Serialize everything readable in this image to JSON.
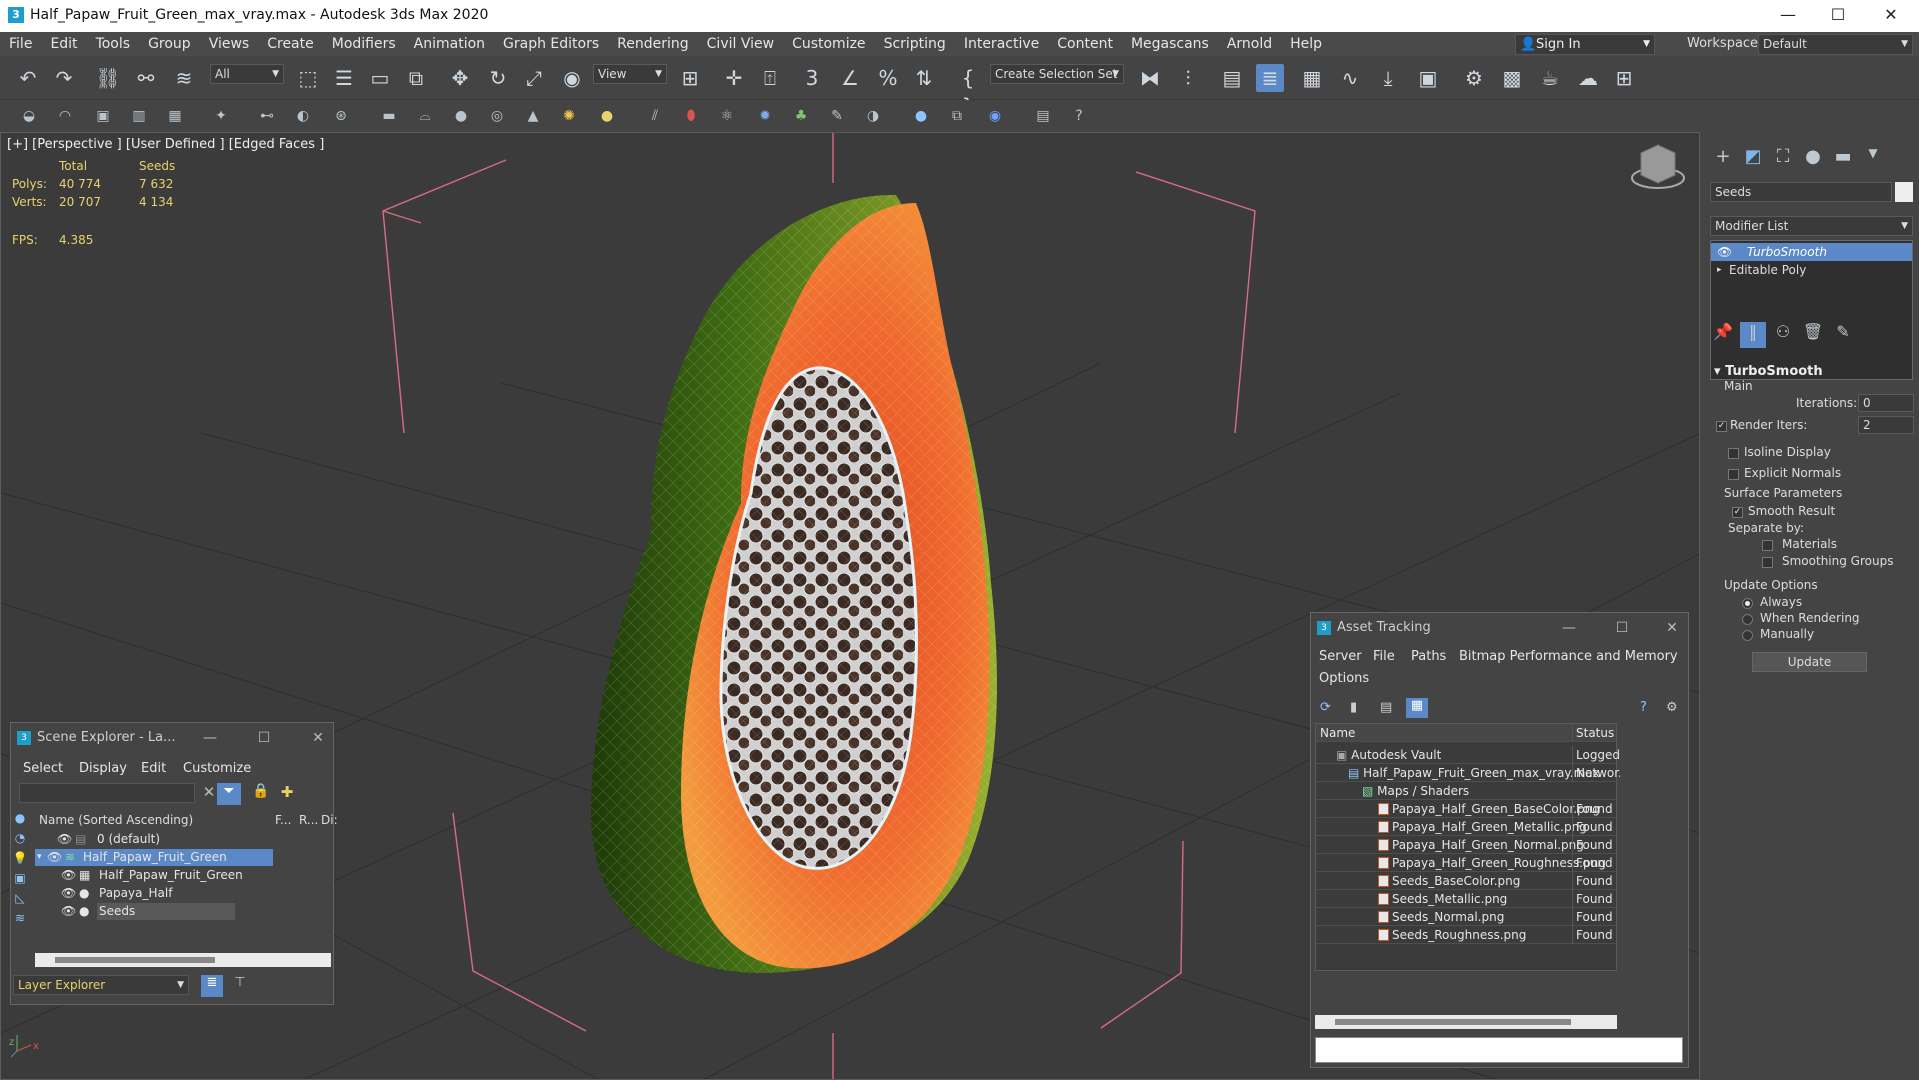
{
  "title_bar": {
    "title": "Half_Papaw_Fruit_Green_max_vray.max - Autodesk 3ds Max 2020"
  },
  "menu": [
    "File",
    "Edit",
    "Tools",
    "Group",
    "Views",
    "Create",
    "Modifiers",
    "Animation",
    "Graph Editors",
    "Rendering",
    "Civil View",
    "Customize",
    "Scripting",
    "Interactive",
    "Content",
    "Megascans",
    "Arnold",
    "Help"
  ],
  "header": {
    "sign_in": "Sign In",
    "workspaces_label": "Workspaces:",
    "workspaces_value": "Default"
  },
  "toolbar": {
    "filter_value": "All",
    "refcoord_value": "View",
    "selection_set": "Create Selection Set"
  },
  "viewport": {
    "label": "[+] [Perspective ] [User Defined ] [Edged Faces ]",
    "stats": {
      "col_total": "Total",
      "col_seeds": "Seeds",
      "polys_label": "Polys:",
      "polys_total": "40 774",
      "polys_seeds": "7 632",
      "verts_label": "Verts:",
      "verts_total": "20 707",
      "verts_seeds": "4 134",
      "fps_label": "FPS:",
      "fps_value": "4.385"
    }
  },
  "command_panel": {
    "object_name": "Seeds",
    "modifier_list": "Modifier List",
    "stack": [
      "TurboSmooth",
      "Editable Poly"
    ],
    "turbosmooth": {
      "title": "TurboSmooth",
      "main": "Main",
      "iterations_label": "Iterations:",
      "iterations_value": "0",
      "render_iters_label": "Render Iters:",
      "render_iters_value": "2",
      "isoline": "Isoline Display",
      "explicit_normals": "Explicit Normals",
      "surface_params": "Surface Parameters",
      "smooth_result": "Smooth Result",
      "separate_by": "Separate by:",
      "materials": "Materials",
      "smoothing_groups": "Smoothing Groups",
      "update_options": "Update Options",
      "always": "Always",
      "when_rendering": "When Rendering",
      "manually": "Manually",
      "update_button": "Update"
    }
  },
  "scene_explorer": {
    "title": "Scene Explorer - La...",
    "menu": [
      "Select",
      "Display",
      "Edit",
      "Customize"
    ],
    "col_name": "Name (Sorted Ascending)",
    "col_f": "F...",
    "col_r": "R...",
    "col_di": "Di:",
    "rows": [
      "0 (default)",
      "Half_Papaw_Fruit_Green",
      "Half_Papaw_Fruit_Green",
      "Papaya_Half",
      "Seeds"
    ],
    "footer": "Layer Explorer"
  },
  "asset_tracking": {
    "title": "Asset Tracking",
    "menu": [
      "Server",
      "File",
      "Paths",
      "Bitmap Performance and Memory"
    ],
    "menu2": "Options",
    "col_name": "Name",
    "col_status": "Status",
    "rows": [
      {
        "name": "Autodesk Vault",
        "status": "Logged..."
      },
      {
        "name": "Half_Papaw_Fruit_Green_max_vray.max",
        "status": "Networ..."
      },
      {
        "name": "Maps / Shaders",
        "status": ""
      },
      {
        "name": "Papaya_Half_Green_BaseColor.png",
        "status": "Found"
      },
      {
        "name": "Papaya_Half_Green_Metallic.png",
        "status": "Found"
      },
      {
        "name": "Papaya_Half_Green_Normal.png",
        "status": "Found"
      },
      {
        "name": "Papaya_Half_Green_Roughness.png",
        "status": "Found"
      },
      {
        "name": "Seeds_BaseColor.png",
        "status": "Found"
      },
      {
        "name": "Seeds_Metallic.png",
        "status": "Found"
      },
      {
        "name": "Seeds_Normal.png",
        "status": "Found"
      },
      {
        "name": "Seeds_Roughness.png",
        "status": "Found"
      }
    ]
  },
  "colors": {
    "accent": "#5b88c6",
    "stats": "#e8d36b",
    "viewport_bg": "#3b3b3b"
  }
}
